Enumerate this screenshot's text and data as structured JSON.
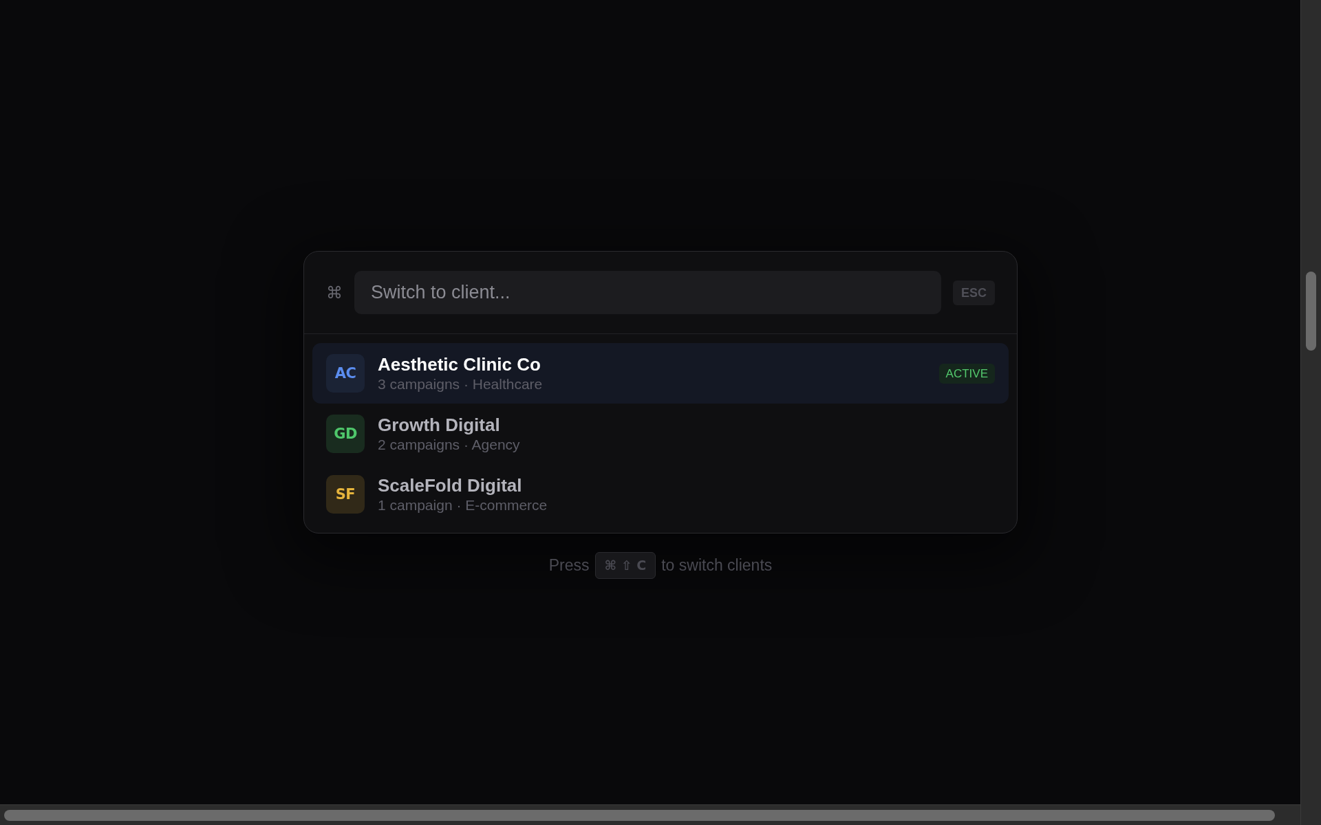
{
  "search": {
    "command_symbol": "⌘",
    "placeholder": "Switch to client...",
    "close_key": "ESC"
  },
  "clients": [
    {
      "initials": "AC",
      "name": "Aesthetic Clinic Co",
      "details": "3 campaigns · Healthcare",
      "color": "#5b8def",
      "status": "ACTIVE",
      "selected": true
    },
    {
      "initials": "GD",
      "name": "Growth Digital",
      "details": "2 campaigns · Agency",
      "color": "#4fc76b",
      "selected": false
    },
    {
      "initials": "SF",
      "name": "ScaleFold Digital",
      "details": "1 campaign · E-commerce",
      "color": "#e6b43c",
      "selected": false
    }
  ],
  "footer": {
    "before": "Press",
    "shortcut": "⌘ ⇧ C",
    "after": "to switch clients"
  }
}
